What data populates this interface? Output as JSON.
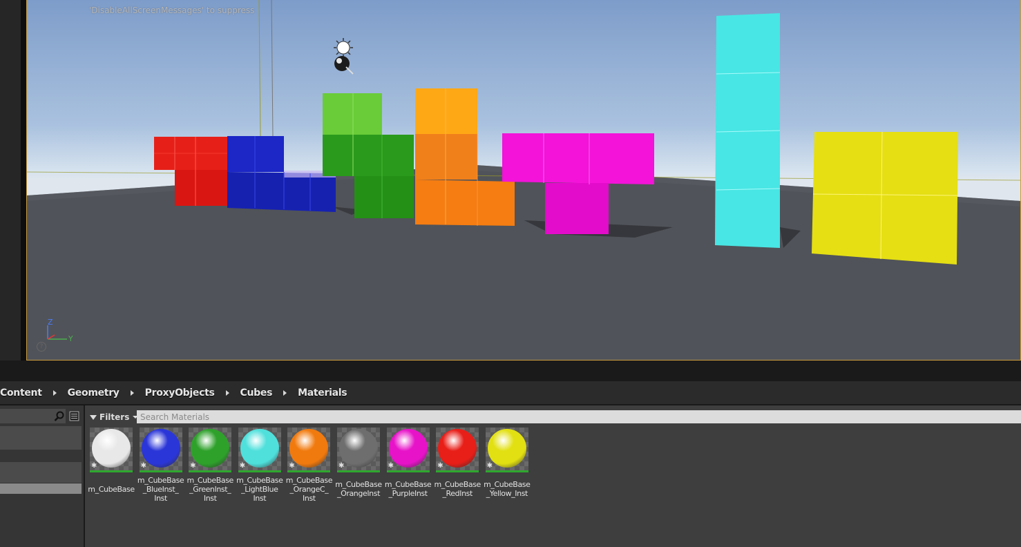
{
  "viewport": {
    "screen_message": "'DisableAllScreenMessages' to suppress",
    "axis": {
      "z": "Z",
      "y": "Y"
    },
    "help": "?",
    "colors": {
      "red": "#e8201c",
      "blue": "#1a27c8",
      "green": "#2aa31c",
      "orange": "#ff8a10",
      "magenta": "#f20fd6",
      "cyan": "#3fe3e2",
      "yellow": "#e7e016",
      "floor": "#4d5056"
    }
  },
  "breadcrumb": {
    "items": [
      "Content",
      "Geometry",
      "ProxyObjects",
      "Cubes",
      "Materials"
    ]
  },
  "content_browser": {
    "filters_label": "Filters",
    "search_placeholder": "Search Materials",
    "assets": [
      {
        "label": "m_CubeBase",
        "color": "#e8e8e8"
      },
      {
        "label": "m_CubeBase\n_BlueInst_\nInst",
        "color": "#2b36d8"
      },
      {
        "label": "m_CubeBase\n_GreenInst_\nInst",
        "color": "#2ea12b"
      },
      {
        "label": "m_CubeBase\n_LightBlue\nInst",
        "color": "#4fe0dc"
      },
      {
        "label": "m_CubeBase\n_OrangeC_\nInst",
        "color": "#f17a0e"
      },
      {
        "label": "m_CubeBase\n_OrangeInst",
        "color": "#6e6e6e"
      },
      {
        "label": "m_CubeBase\n_PurpleInst",
        "color": "#e713c9"
      },
      {
        "label": "m_CubeBase\n_RedInst",
        "color": "#e81e18"
      },
      {
        "label": "m_CubeBase\n_Yellow_Inst",
        "color": "#e2e012"
      }
    ]
  }
}
